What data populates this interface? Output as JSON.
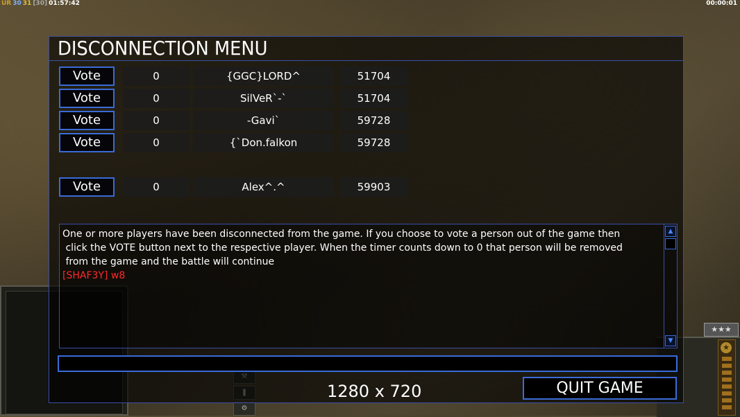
{
  "hud": {
    "tag": "UR",
    "val1": "30",
    "val2": "31",
    "bracket": "[30]",
    "time_left": "01:57:42",
    "time_right": "00:00:01"
  },
  "menu": {
    "title": "DISCONNECTION MENU",
    "vote_label": "Vote",
    "players": [
      {
        "votes": "0",
        "name": "{GGC}LORD^",
        "timer": "51704"
      },
      {
        "votes": "0",
        "name": "SilVeR`-`",
        "timer": "51704"
      },
      {
        "votes": "0",
        "name": "-Gavi`",
        "timer": "59728"
      },
      {
        "votes": "0",
        "name": "{`Don.falkon",
        "timer": "59728"
      },
      {
        "votes": "0",
        "name": "Alex^.^",
        "timer": "59903"
      }
    ],
    "info_line1": "One or more players have been disconnected from the game. If you choose to vote a person out of the game then",
    "info_line2": " click the VOTE button next to the respective player. When the timer counts down to 0 that person will be removed",
    "info_line3": " from the game and the battle will continue",
    "chat_message": "[SHAF3Y] w8",
    "chat_input_value": "",
    "resolution": "1280 x 720",
    "quit_label": "QUIT GAME"
  },
  "rank_stars": "★★★",
  "colors": {
    "accent_blue": "#3a6bd8",
    "chat_red": "#ff2a2a"
  }
}
